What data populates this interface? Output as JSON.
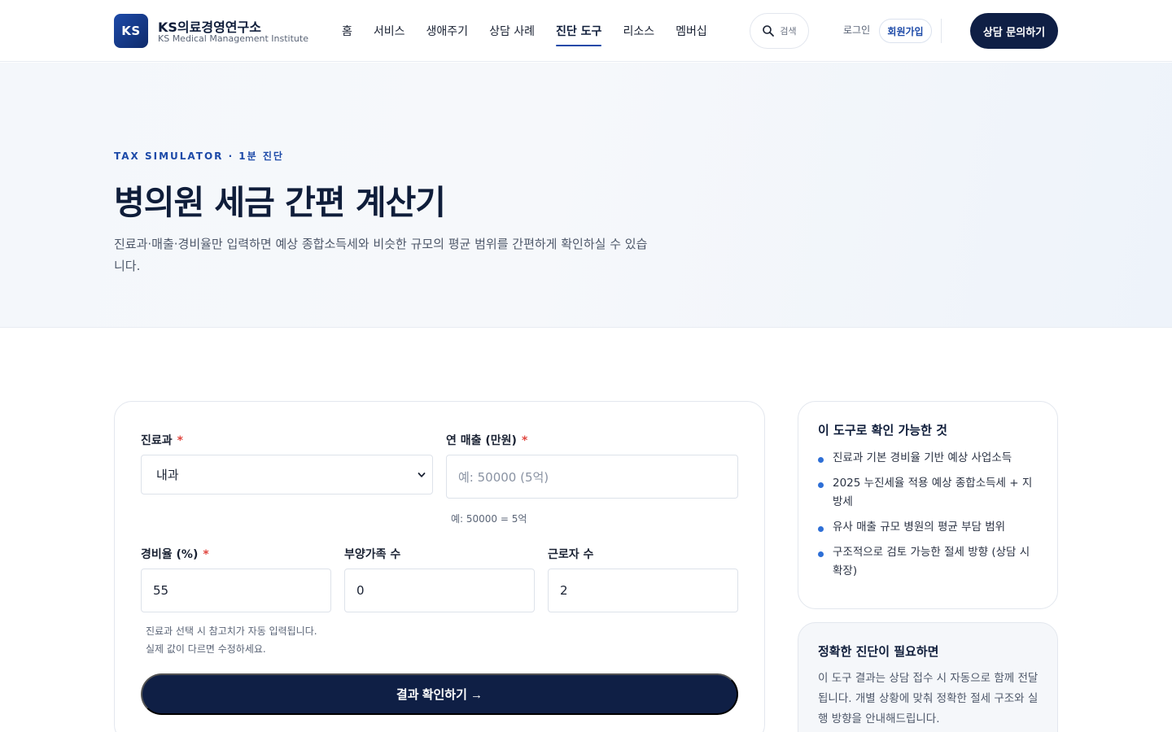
{
  "header": {
    "logo_badge": "KS",
    "logo_name": "KS의료경영연구소",
    "logo_sub": "KS Medical Management Institute",
    "nav": [
      "홈",
      "서비스",
      "생애주기",
      "상담 사례",
      "진단 도구",
      "리소스",
      "멤버십"
    ],
    "active_nav": "진단 도구",
    "search_label": "검색",
    "login_label": "로그인",
    "signup_label": "회원가입",
    "consult_label": "상담 문의하기"
  },
  "hero": {
    "eyebrow": "TAX SIMULATOR · 1분 진단",
    "title": "병의원 세금 간편 계산기",
    "description": "진료과·매출·경비율만 입력하면 예상 종합소득세와 비슷한 규모의 평균 범위를 간편하게 확인하실 수 있습니다."
  },
  "form": {
    "department": {
      "label": "진료과",
      "required_mark": "*",
      "value": "내과"
    },
    "revenue": {
      "label": "연 매출 (만원)",
      "required_mark": "*",
      "placeholder": "예: 50000 (5억)",
      "hint": "예: 50000 = 5억"
    },
    "expense_rate": {
      "label": "경비율 (%)",
      "required_mark": "*",
      "value": "55"
    },
    "dependents": {
      "label": "부양가족 수",
      "value": "0"
    },
    "employees": {
      "label": "근로자 수",
      "value": "2"
    },
    "hint_line1": "진료과 선택 시 참고치가 자동 입력됩니다.",
    "hint_line2": "실제 값이 다르면 수정하세요.",
    "submit_label": "결과 확인하기 →"
  },
  "side": {
    "card1_title": "이 도구로 확인 가능한 것",
    "card1_items": [
      "진료과 기본 경비율 기반 예상 사업소득",
      "2025 누진세율 적용 예상 종합소득세 + 지방세",
      "유사 매출 규모 병원의 평균 부담 범위",
      "구조적으로 검토 가능한 절세 방향 (상담 시 확장)"
    ],
    "card2_title": "정확한 진단이 필요하면",
    "card2_desc": "이 도구 결과는 상담 접수 시 자동으로 함께 전달됩니다. 개별 상황에 맞춰 정확한 절세 구조와 실행 방향을 안내해드립니다."
  },
  "colors": {
    "brand_navy": "#0f1f45",
    "accent_blue": "#1d4aa8",
    "required_red": "#e0463f",
    "bullet_blue": "#2e6fd6"
  }
}
